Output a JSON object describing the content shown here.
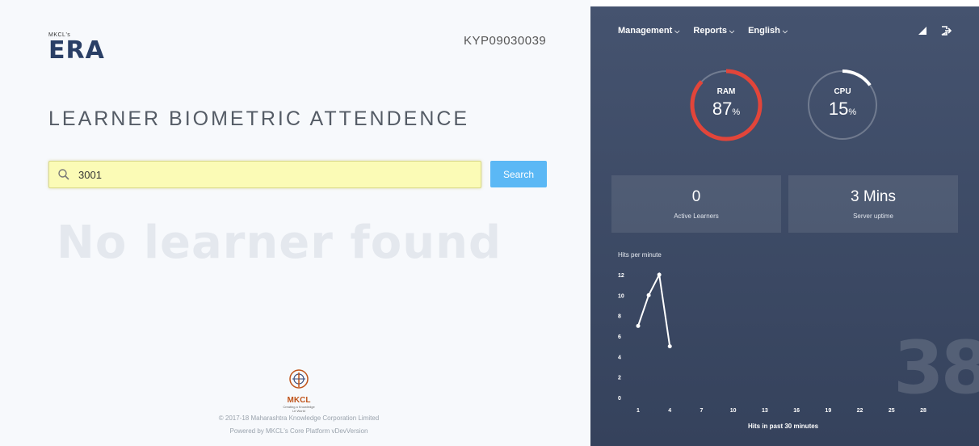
{
  "logo": {
    "small": "MKCL's",
    "big": "ERA"
  },
  "center_code": "KYP09030039",
  "page_title": "LEARNER BIOMETRIC ATTENDENCE",
  "search": {
    "value": "3001",
    "button": "Search"
  },
  "empty_message": "No learner found",
  "footer": {
    "logo_name": "MKCL",
    "tagline": "Creating a Knowledge Lit World",
    "copyright": "© 2017-18 Maharashtra Knowledge Corporation Limited",
    "powered": "Powered by MKCL's Core Platform vDevVersion"
  },
  "nav": {
    "management": "Management",
    "reports": "Reports",
    "language": "English"
  },
  "ram": {
    "label": "RAM",
    "value": "87",
    "unit": "%",
    "fraction": 0.87,
    "color": "#e2453a"
  },
  "cpu": {
    "label": "CPU",
    "value": "15",
    "unit": "%",
    "fraction": 0.15,
    "color": "#ffffff"
  },
  "stats": {
    "active_learners": {
      "value": "0",
      "label": "Active Learners"
    },
    "uptime": {
      "value": "3 Mins",
      "label": "Server uptime"
    }
  },
  "big_counter": "38",
  "chart_data": {
    "type": "line",
    "title": "Hits per minute",
    "xlabel": "Hits in past 30 minutes",
    "ylabel": "",
    "x_ticks": [
      1,
      4,
      7,
      10,
      13,
      16,
      19,
      22,
      25,
      28
    ],
    "y_ticks": [
      0,
      2,
      4,
      6,
      8,
      10,
      12
    ],
    "xlim": [
      1,
      28
    ],
    "ylim": [
      0,
      12
    ],
    "series": [
      {
        "x": [
          1,
          2,
          3,
          4
        ],
        "y": [
          7,
          10,
          12,
          5
        ]
      }
    ]
  }
}
